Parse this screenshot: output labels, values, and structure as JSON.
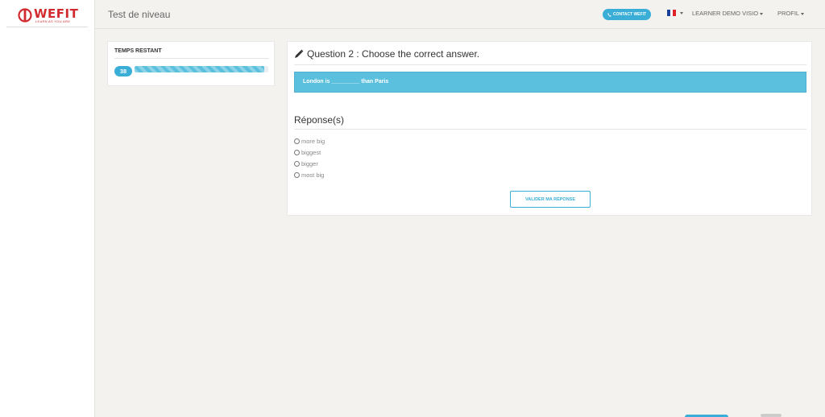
{
  "brand": {
    "name": "WEFIT",
    "tagline": "LEARN AS YOU ARE",
    "color": "#d12a2f"
  },
  "header": {
    "title": "Test de niveau",
    "contact_label": "CONTACT WEFIT",
    "contact_icon": "phone-icon",
    "language_icon": "french-flag-icon",
    "user_label": "LEARNER DEMO VISIO",
    "profile_label": "PROFIL"
  },
  "timer": {
    "title": "TEMPS RESTANT",
    "value": "38",
    "progress_percent": 97
  },
  "question": {
    "icon": "pencil-icon",
    "title": "Question 2 : Choose the correct answer.",
    "prompt": "London is _________ than Paris",
    "responses_title": "Réponse(s)",
    "options": [
      "more big",
      "biggest",
      "bigger",
      "most big"
    ],
    "submit_label": "VALIDER MA RÉPONSE"
  },
  "colors": {
    "accent": "#3aaed6",
    "prompt_bg": "#5bc0de",
    "page_bg": "#f3f2ef"
  }
}
